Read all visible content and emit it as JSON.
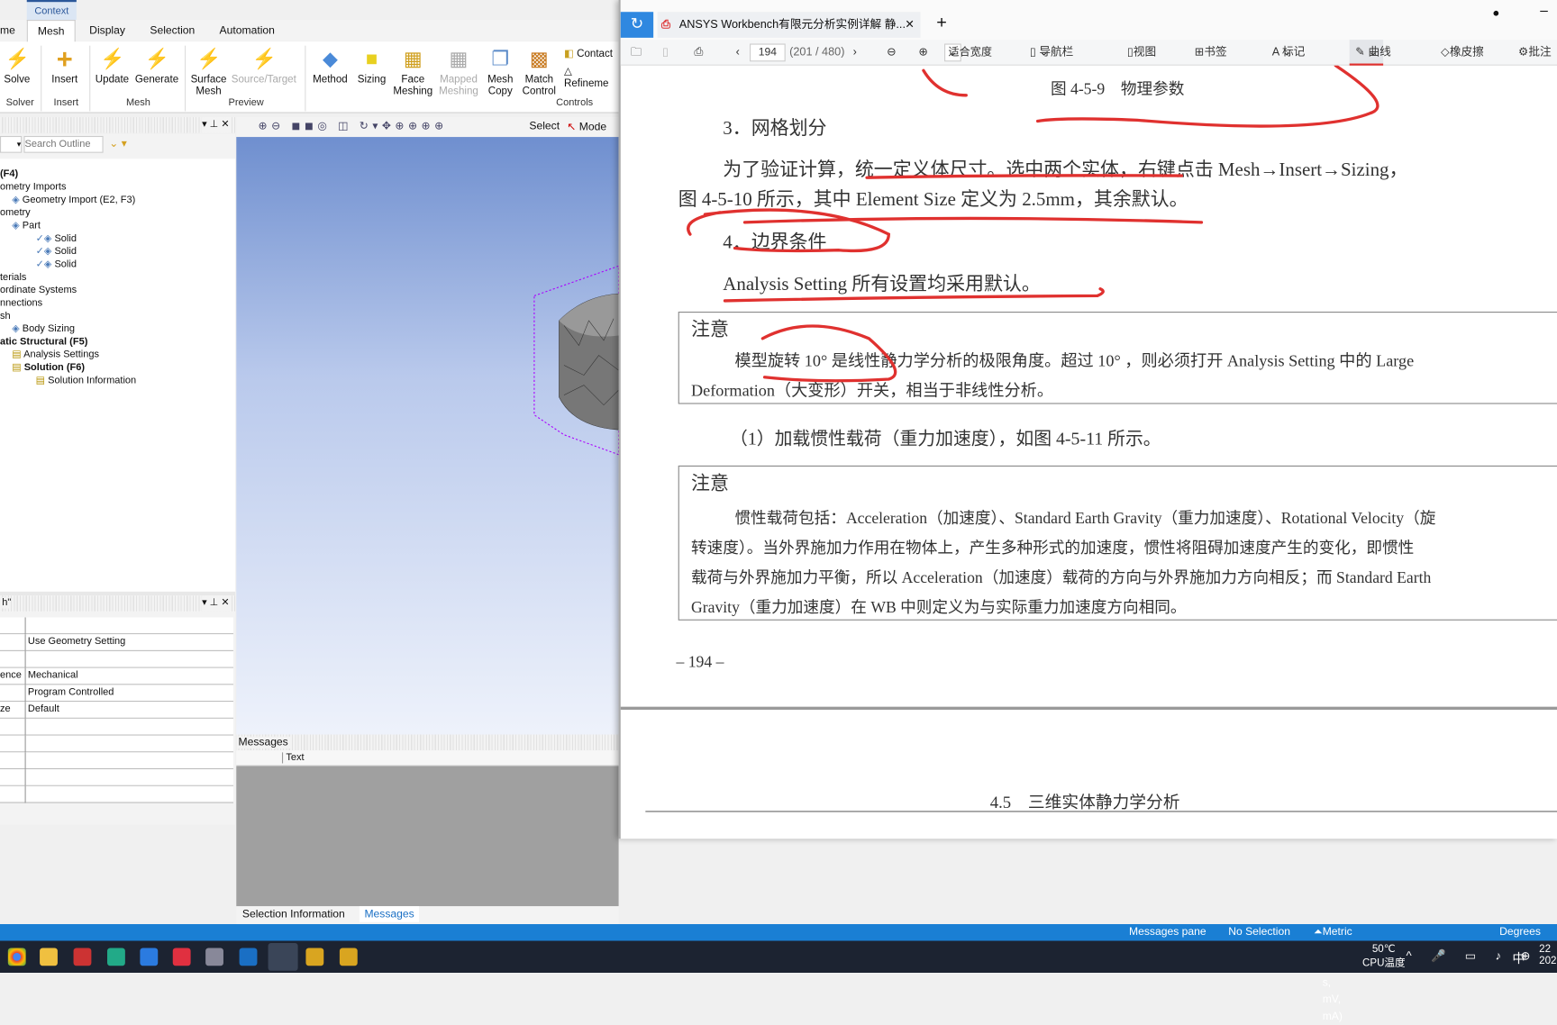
{
  "ribbon": {
    "context_label": "Context",
    "tabs": [
      "me",
      "Mesh",
      "Display",
      "Selection",
      "Automation"
    ],
    "buttons": [
      {
        "label": "Solve",
        "icon": "lightning-icon"
      },
      {
        "label": "Insert",
        "icon": "plus-icon"
      },
      {
        "label": "Update",
        "icon": "update-icon"
      },
      {
        "label": "Generate",
        "icon": "generate-icon"
      },
      {
        "label": "Surface\nMesh",
        "icon": "surface-mesh-icon"
      },
      {
        "label": "Source/Target",
        "icon": "source-target-icon"
      },
      {
        "label": "Method",
        "icon": "method-icon"
      },
      {
        "label": "Sizing",
        "icon": "sizing-icon"
      },
      {
        "label": "Face\nMeshing",
        "icon": "face-meshing-icon"
      },
      {
        "label": "Mapped\nMeshing",
        "icon": "mapped-meshing-icon"
      },
      {
        "label": "Mesh\nCopy",
        "icon": "mesh-copy-icon"
      },
      {
        "label": "Match\nControl",
        "icon": "match-control-icon"
      },
      {
        "label": "Contact",
        "icon": "contact-icon"
      },
      {
        "label": "Refineme",
        "icon": "refinement-icon"
      }
    ],
    "groups": [
      "Solver",
      "Insert",
      "Mesh",
      "Preview",
      "Controls"
    ]
  },
  "outline": {
    "search_placeholder": "Search Outline",
    "items": [
      "(F4)",
      "ometry Imports",
      "Geometry Import (E2, F3)",
      "ometry",
      "Part",
      "Solid",
      "Solid",
      "Solid",
      "terials",
      "ordinate Systems",
      "nnections",
      "sh",
      "Body Sizing",
      "atic Structural (F5)",
      "Analysis Settings",
      "Solution (F6)",
      "Solution Information"
    ]
  },
  "details": {
    "title": "h\"",
    "rows": [
      {
        "k": "",
        "v": ""
      },
      {
        "k": "",
        "v": "Use Geometry Setting"
      },
      {
        "k": "",
        "v": ""
      },
      {
        "k": "ence",
        "v": "Mechanical"
      },
      {
        "k": "",
        "v": "Program Controlled"
      },
      {
        "k": "ze",
        "v": "Default"
      },
      {
        "k": "",
        "v": ""
      },
      {
        "k": "",
        "v": ""
      },
      {
        "k": "",
        "v": ""
      },
      {
        "k": "",
        "v": ""
      },
      {
        "k": "",
        "v": ""
      }
    ]
  },
  "viewport_toolbar": {
    "select": "Select",
    "mode": "Mode"
  },
  "messages": {
    "title": "Messages",
    "column": "Text",
    "tabs": [
      "Selection Information",
      "Messages"
    ]
  },
  "status": {
    "messages_pane": "Messages pane",
    "selection": "No Selection",
    "units": "Metric (mm, kg, N, s, mV, mA)",
    "angle": "Degrees"
  },
  "taskbar": {
    "temp": "50℃",
    "temp_label": "CPU温度",
    "ime": "中",
    "time": "22",
    "date": "202"
  },
  "pdf": {
    "tab_title": "ANSYS  Workbench有限元分析实例详解  静...",
    "page_input": "194",
    "page_info": "(201 / 480)",
    "fit": "适合宽度",
    "nav": "导航栏",
    "view": "视图",
    "bookmark": "书签",
    "mark": "标记",
    "curve": "曲线",
    "eraser": "橡皮擦",
    "annotate": "批注",
    "content": {
      "fig_caption": "图 4-5-9　物理参数",
      "h3": "3．网格划分",
      "p1a": "为了验证计算，统一定义体尺寸。选中两个实体，右键点击 Mesh→Insert→Sizing，",
      "p1b": "图 4-5-10 所示，其中 Element Size 定义为 2.5mm，其余默认。",
      "h4": "4．边界条件",
      "p2": "Analysis Setting 所有设置均采用默认。",
      "note_title": "注意",
      "note1a": "模型旋转 10° 是线性静力学分析的极限角度。超过 10° ，则必须打开 Analysis Setting 中的 Large",
      "note1b": "Deformation（大变形）开关，相当于非线性分析。",
      "p3": "（1）加载惯性载荷（重力加速度），如图 4-5-11 所示。",
      "note2_title": "注意",
      "note2a": "惯性载荷包括：Acceleration（加速度）、Standard Earth Gravity（重力加速度）、Rotational Velocity（旋",
      "note2b": "转速度）。当外界施加力作用在物体上，产生多种形式的加速度，惯性将阻碍加速度产生的变化，即惯性",
      "note2c": "载荷与外界施加力平衡，所以 Acceleration（加速度）载荷的方向与外界施加力方向相反；而 Standard Earth",
      "note2d": "Gravity（重力加速度）在 WB 中则定义为与实际重力加速度方向相同。",
      "page_num": "– 194 –",
      "next_header": "4.5　三维实体静力学分析"
    }
  },
  "colors": {
    "status_bar": "#1a7fd4",
    "annotation": "#e0312f",
    "taskbar": "#1c2331"
  }
}
